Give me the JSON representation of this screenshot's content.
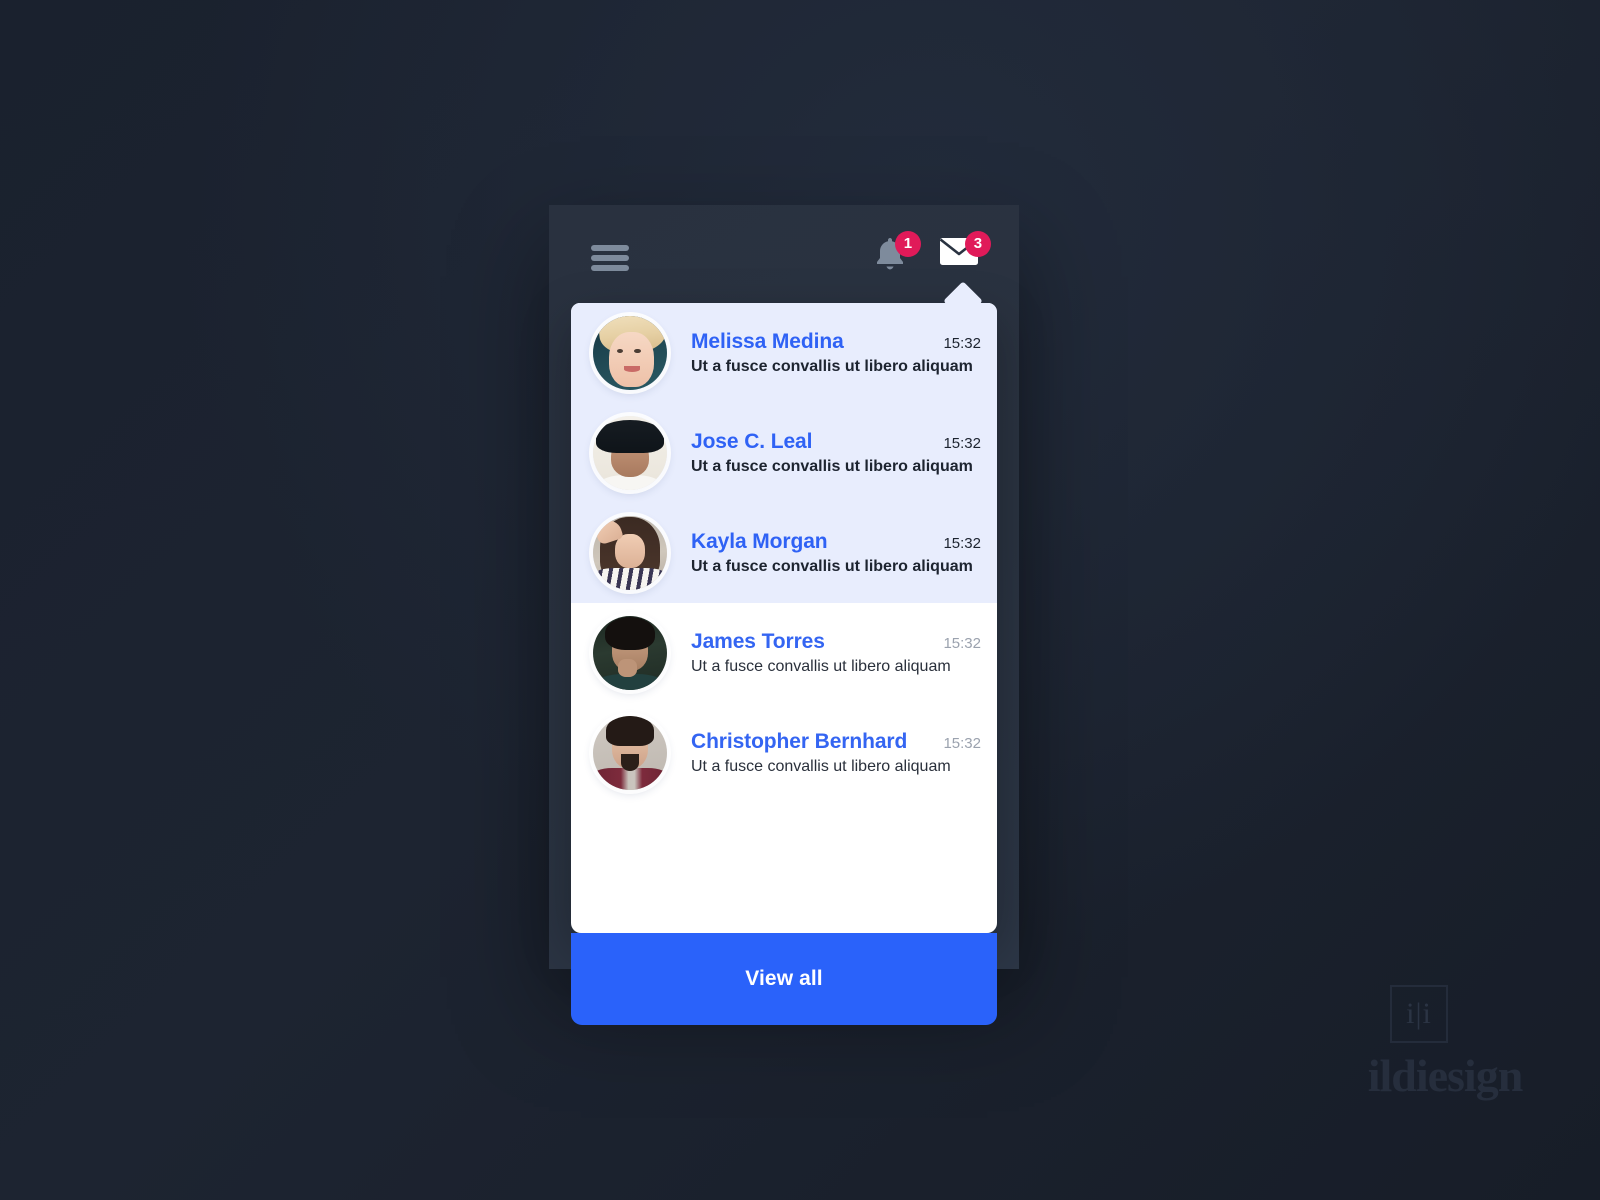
{
  "app": {
    "background_color": "#1b2230",
    "device_color": "#2a3341"
  },
  "topbar": {
    "menu_icon": "hamburger-menu-icon",
    "bell": {
      "icon": "bell-icon",
      "badge_count": "1",
      "badge_color": "#e01a59",
      "icon_color": "#7e8b9c"
    },
    "mail": {
      "icon": "envelope-icon",
      "badge_count": "3",
      "badge_color": "#e01a59",
      "icon_color": "#ffffff"
    }
  },
  "dropdown": {
    "unread_background": "#e8edfd",
    "read_background": "#ffffff",
    "name_color": "#2f62f5",
    "notifications": [
      {
        "name": "Melissa Medina",
        "message": "Ut a fusce convallis ut libero aliquam",
        "time": "15:32",
        "state": "unread",
        "avatar": "avatar-melissa-medina"
      },
      {
        "name": "Jose C. Leal",
        "message": "Ut a fusce convallis ut libero aliquam",
        "time": "15:32",
        "state": "unread",
        "avatar": "avatar-jose-c-leal"
      },
      {
        "name": "Kayla Morgan",
        "message": "Ut a fusce convallis ut libero aliquam",
        "time": "15:32",
        "state": "unread",
        "avatar": "avatar-kayla-morgan"
      },
      {
        "name": "James Torres",
        "message": "Ut a fusce convallis ut libero aliquam",
        "time": "15:32",
        "state": "read",
        "avatar": "avatar-james-torres"
      },
      {
        "name": "Christopher Bernhard",
        "message": "Ut a fusce convallis ut libero aliquam",
        "time": "15:32",
        "state": "read",
        "avatar": "avatar-christopher-bernhard"
      }
    ],
    "view_all_label": "View all",
    "view_all_color": "#2a62fa"
  },
  "watermark": {
    "mark": "i|i",
    "word": "ildiesign"
  }
}
